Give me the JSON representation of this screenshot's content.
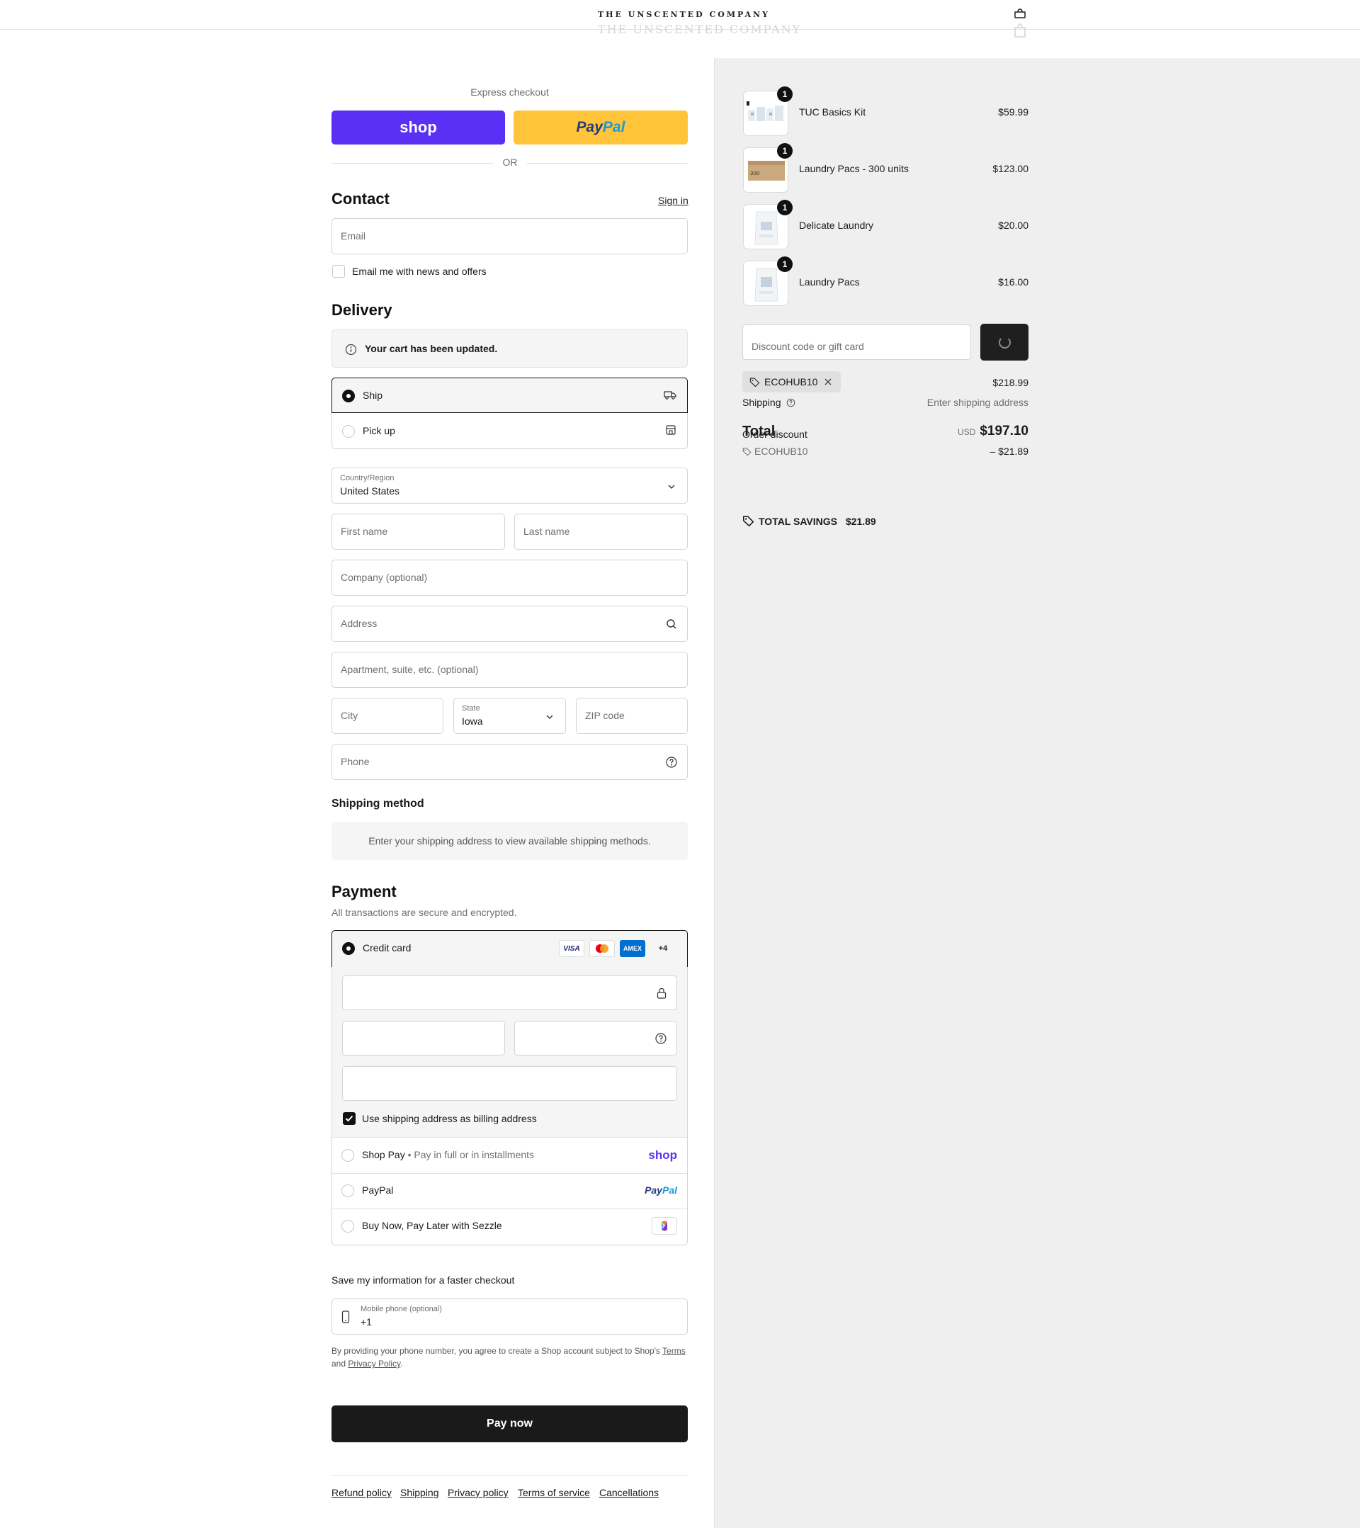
{
  "header": {
    "brand": "THE UNSCENTED COMPANY",
    "brand_ghost": "THE UNSCENTED COMPANY"
  },
  "express": {
    "label": "Express checkout",
    "shop_label": "shop",
    "paypal_part1": "Pay",
    "paypal_part2": "Pal",
    "or": "OR"
  },
  "contact": {
    "heading": "Contact",
    "sign_in": "Sign in",
    "email_placeholder": "Email",
    "newsletter_label": "Email me with news and offers",
    "newsletter_checked": false
  },
  "delivery": {
    "heading": "Delivery",
    "notice": "Your cart has been updated.",
    "options": [
      {
        "label": "Ship",
        "selected": true,
        "icon": "truck-icon"
      },
      {
        "label": "Pick up",
        "selected": false,
        "icon": "store-icon"
      }
    ],
    "country_label": "Country/Region",
    "country_value": "United States",
    "first_name": "First name",
    "last_name": "Last name",
    "company": "Company (optional)",
    "address": "Address",
    "apartment": "Apartment, suite, etc. (optional)",
    "city": "City",
    "state_label": "State",
    "state_value": "Iowa",
    "zip": "ZIP code",
    "phone": "Phone"
  },
  "shipping_method": {
    "heading": "Shipping method",
    "message": "Enter your shipping address to view available shipping methods."
  },
  "payment": {
    "heading": "Payment",
    "subtitle": "All transactions are secure and encrypted.",
    "credit_card_label": "Credit card",
    "card_brands": [
      "VISA",
      "mastercard",
      "AMEX",
      "+4"
    ],
    "billing_same_label": "Use shipping address as billing address",
    "billing_same_checked": true,
    "shop_pay_label": "Shop Pay",
    "shop_pay_sub": "Pay in full or in installments",
    "shop_pay_logo": "shop",
    "paypal_label": "PayPal",
    "paypal_logo_1": "Pay",
    "paypal_logo_2": "Pal",
    "sezzle_label": "Buy Now, Pay Later with Sezzle"
  },
  "save_info": {
    "heading": "Save my information for a faster checkout",
    "mobile_label": "Mobile phone (optional)",
    "mobile_value": "+1",
    "legal_1": "By providing your phone number, you agree to create a Shop account subject to Shop's",
    "terms": "Terms",
    "and": "and",
    "privacy": "Privacy Policy",
    "period": "."
  },
  "pay_now": "Pay now",
  "footer": {
    "links": [
      "Refund policy",
      "Shipping",
      "Privacy policy",
      "Terms of service",
      "Cancellations"
    ]
  },
  "summary": {
    "items": [
      {
        "name": "TUC Basics Kit",
        "price": "$59.99",
        "qty": "1"
      },
      {
        "name": "Laundry Pacs - 300 units",
        "price": "$123.00",
        "qty": "1"
      },
      {
        "name": "Delicate Laundry",
        "price": "$20.00",
        "qty": "1"
      },
      {
        "name": "Laundry Pacs",
        "price": "$16.00",
        "qty": "1"
      }
    ],
    "discount_placeholder": "Discount code or gift card",
    "code": "ECOHUB10",
    "subtotal": "$218.99",
    "shipping_label": "Shipping",
    "shipping_value": "Enter shipping address",
    "total_label": "Total",
    "order_discount_label": "Order discount",
    "currency": "USD",
    "total": "$197.10",
    "discount_code": "ECOHUB10",
    "discount_value": "– $21.89",
    "savings_label": "TOTAL SAVINGS",
    "savings_value": "$21.89"
  }
}
